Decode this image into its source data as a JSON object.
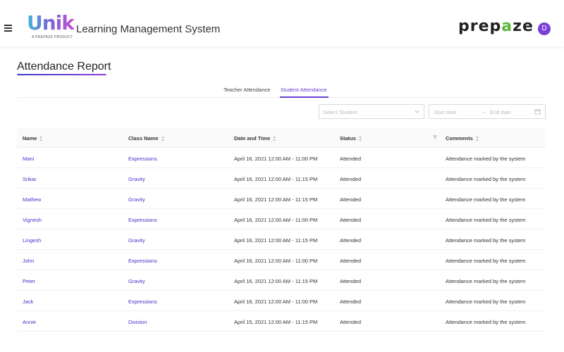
{
  "header": {
    "logo_text": "Unik",
    "logo_sub": "A PREPAZE PRODUCT",
    "app_title": "Learning Management System",
    "brand_prefix": "prep",
    "brand_accent": "a",
    "brand_suffix": "ze",
    "avatar_letter": "D"
  },
  "page": {
    "title": "Attendance Report"
  },
  "tabs": [
    {
      "label": "Teacher Attendance",
      "active": false
    },
    {
      "label": "Student Attendance",
      "active": true
    }
  ],
  "filters": {
    "student_placeholder": "Select Student",
    "start_placeholder": "Start date",
    "end_placeholder": "End date"
  },
  "table": {
    "columns": [
      "Name",
      "Class Name",
      "Date and Time",
      "Status",
      "Comments"
    ],
    "rows": [
      {
        "name": "Mani",
        "class": "Expressions",
        "datetime": "April 16, 2021 12:00 AM - 11:00 PM",
        "status": "Attended",
        "comment": "Attendance marked by the system"
      },
      {
        "name": "Srikar",
        "class": "Gravity",
        "datetime": "April 16, 2021 12:00 AM - 11:15 PM",
        "status": "Attended",
        "comment": "Attendance marked by the system"
      },
      {
        "name": "Mathew",
        "class": "Gravity",
        "datetime": "April 16, 2021 12:00 AM - 11:15 PM",
        "status": "Attended",
        "comment": "Attendance marked by the system"
      },
      {
        "name": "Vignesh",
        "class": "Expressions",
        "datetime": "April 16, 2021 12:00 AM - 11:00 PM",
        "status": "Attended",
        "comment": "Attendance marked by the system"
      },
      {
        "name": "Lingesh",
        "class": "Gravity",
        "datetime": "April 16, 2021 12:00 AM - 11:15 PM",
        "status": "Attended",
        "comment": "Attendance marked by the system"
      },
      {
        "name": "John",
        "class": "Expressions",
        "datetime": "April 16, 2021 12:00 AM - 11:00 PM",
        "status": "Attended",
        "comment": "Attendance marked by the system"
      },
      {
        "name": "Peter",
        "class": "Gravity",
        "datetime": "April 16, 2021 12:00 AM - 11:15 PM",
        "status": "Attended",
        "comment": "Attendance marked by the system"
      },
      {
        "name": "Jack",
        "class": "Expressions",
        "datetime": "April 16, 2021 12:00 AM - 11:00 PM",
        "status": "Attended",
        "comment": "Attendance marked by the system"
      },
      {
        "name": "Annie",
        "class": "Division",
        "datetime": "April 15, 2021 12:00 AM - 11:15 PM",
        "status": "Attended",
        "comment": "Attendance marked by the system"
      }
    ]
  },
  "colors": {
    "accent": "#6a3fd6",
    "link": "#4b2fc9",
    "brand_green": "#5ab43a",
    "avatar_bg": "#7b3fd6"
  },
  "icons": {
    "menu": "hamburger-icon",
    "select": "chevron-down-icon",
    "date_separator": "arrow-right-icon",
    "calendar": "calendar-icon",
    "status_filter": "filter-icon",
    "sort": "sort-icon"
  }
}
